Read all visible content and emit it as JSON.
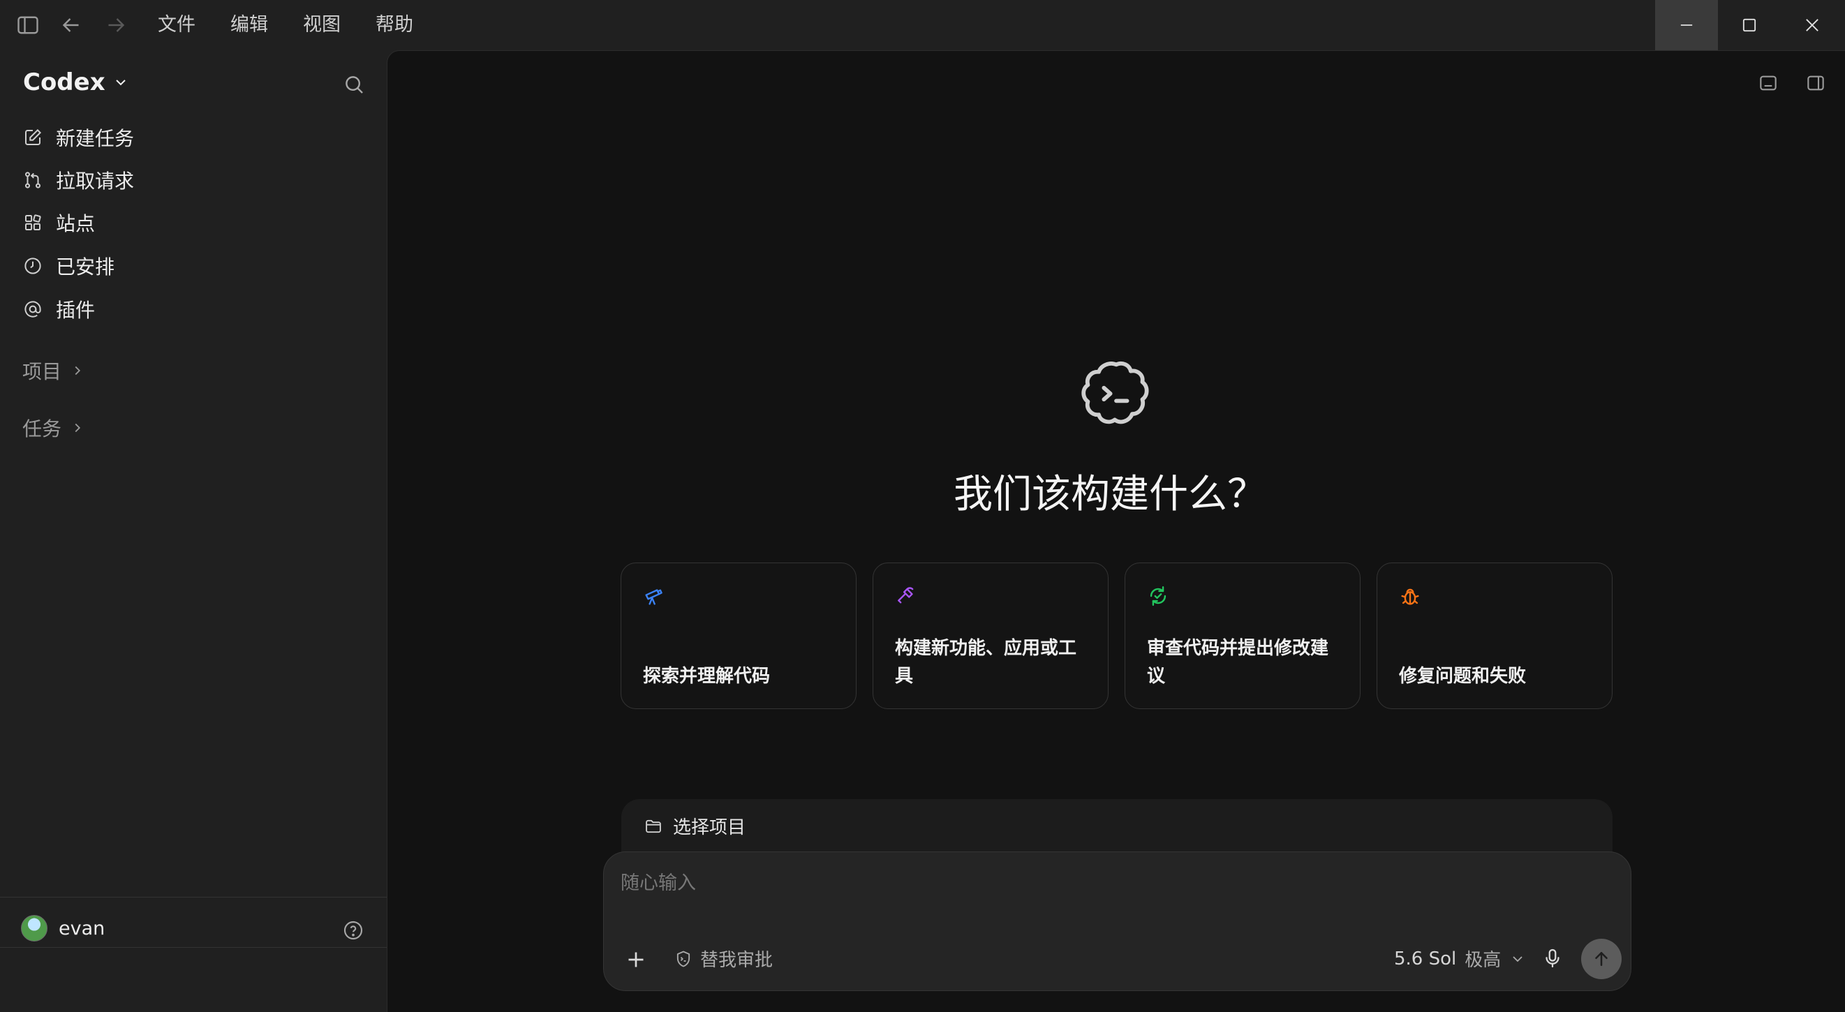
{
  "titlebar": {
    "menus": [
      "文件",
      "编辑",
      "视图",
      "帮助"
    ],
    "icons": [
      "sidebar-toggle-icon",
      "back-arrow-icon",
      "forward-arrow-icon"
    ],
    "window_controls": [
      "minimize-icon",
      "maximize-icon",
      "close-icon"
    ]
  },
  "sidebar": {
    "brand": "Codex",
    "nav": [
      {
        "label": "新建任务",
        "icon": "edit-icon"
      },
      {
        "label": "拉取请求",
        "icon": "git-pull-request-icon"
      },
      {
        "label": "站点",
        "icon": "sites-grid-icon"
      },
      {
        "label": "已安排",
        "icon": "clock-icon"
      },
      {
        "label": "插件",
        "icon": "at-sign-icon"
      }
    ],
    "sections": [
      "项目",
      "任务"
    ],
    "user": "evan"
  },
  "main": {
    "headline": "我们该构建什么？",
    "cards": [
      {
        "label": "探索并理解代码",
        "icon": "telescope-icon",
        "color": "#3b82f6"
      },
      {
        "label": "构建新功能、应用或工具",
        "icon": "hammer-icon",
        "color": "#a855f7"
      },
      {
        "label": "审查代码并提出修改建议",
        "icon": "refresh-check-icon",
        "color": "#22c55e"
      },
      {
        "label": "修复问题和失败",
        "icon": "bug-icon",
        "color": "#f97316"
      }
    ],
    "project_selector": "选择项目",
    "composer": {
      "placeholder": "随心输入",
      "approval": "替我审批",
      "model": "5.6 Sol",
      "effort": "极高"
    }
  }
}
